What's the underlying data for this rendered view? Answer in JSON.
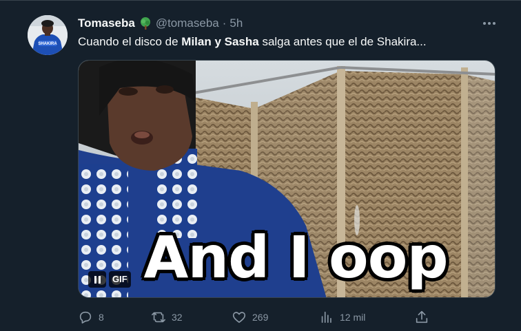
{
  "tweet": {
    "author_name": "Tomaseba",
    "handle": "@tomaseba",
    "separator": "·",
    "time": "5h",
    "text_before": "Cuando el disco de ",
    "text_bold": "Milan y Sasha",
    "text_after": " salga antes que el de Shakira...",
    "badge_icon": "tree-icon",
    "avatar_jersey_text": "SHAKIRA"
  },
  "media": {
    "caption": "And I oop",
    "gif_label": "GIF",
    "pause_icon": "pause-icon"
  },
  "actions": {
    "replies": "8",
    "retweets": "32",
    "likes": "269",
    "views": "12 mil"
  },
  "colors": {
    "background": "#15202b",
    "text": "#f7f9f9",
    "secondary_text": "#8b98a5",
    "border": "#38444d"
  }
}
